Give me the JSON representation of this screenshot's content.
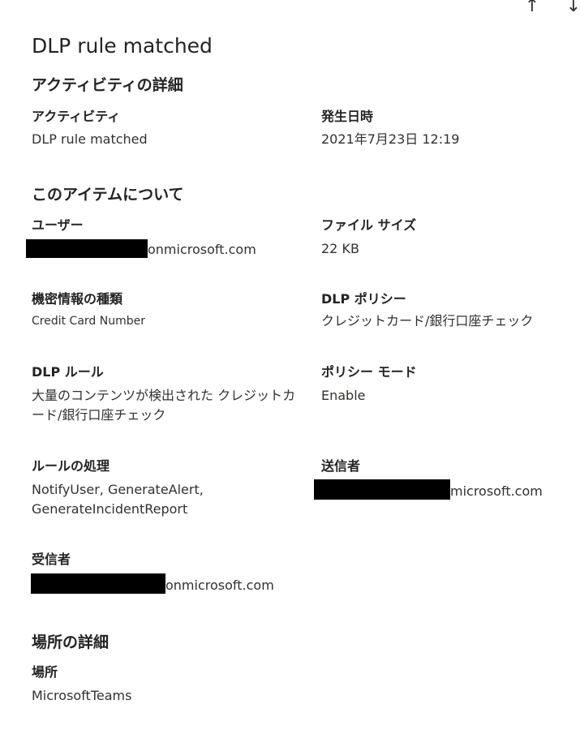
{
  "nav": {
    "prev_glyph": "↑",
    "next_glyph": "↓"
  },
  "title": "DLP rule matched",
  "activity_section": {
    "heading": "アクティビティの詳細",
    "activity_label": "アクティビティ",
    "activity_value": "DLP rule matched",
    "time_label": "発生日時",
    "time_value": "2021年7月23日 12:19"
  },
  "item_section": {
    "heading": "このアイテムについて",
    "user_label": "ユーザー",
    "user_value_suffix": "onmicrosoft.com",
    "file_size_label": "ファイル サイズ",
    "file_size_value": "22 KB",
    "sensitive_info_label": "機密情報の種類",
    "sensitive_info_value": "Credit Card Number",
    "dlp_policy_label": "DLP ポリシー",
    "dlp_policy_value": "クレジットカード/銀行口座チェック",
    "dlp_rule_label": "DLP ルール",
    "dlp_rule_value_line1": "大量のコンテンツが検出された クレジットカ",
    "dlp_rule_value_line2": "ード/銀行口座チェック",
    "policy_mode_label": "ポリシー モード",
    "policy_mode_value": "Enable",
    "rule_actions_label": "ルールの処理",
    "rule_actions_line1": "NotifyUser, GenerateAlert,",
    "rule_actions_line2": "GenerateIncidentReport",
    "sender_label": "送信者",
    "sender_value_suffix": "microsoft.com",
    "recipient_label": "受信者",
    "recipient_value_suffix": "onmicrosoft.com"
  },
  "location_section": {
    "heading": "場所の詳細",
    "location_label": "場所",
    "location_value": "MicrosoftTeams"
  }
}
